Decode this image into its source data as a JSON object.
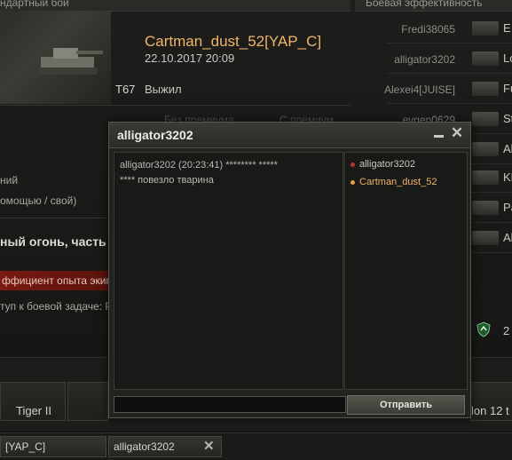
{
  "background": {
    "header_left": "ндартный бой",
    "header_right": "Боевая эффективность",
    "player_name": "Cartman_dust_52[YAP_C]",
    "battle_date": "22.10.2017 20:09",
    "tank_name": "T67",
    "status": "Выжил",
    "faded_col1": "Без премиума",
    "faded_col2": "С премиум",
    "left_line1": "ний",
    "left_line2": "омощью / свой)",
    "mission_title": "ный огонь, часть 1",
    "xp_bar": "ффициент опыта экипа",
    "access_line": "туп к боевой задаче: Р",
    "vehicle_left": "Tiger II",
    "vehicle_right": "lon 12 t",
    "right_count": "2",
    "team_rows": [
      {
        "name": "Fredi38065",
        "letter": "E"
      },
      {
        "name": "alligator3202",
        "letter": "Lo"
      },
      {
        "name": "Alexei4[JUISE]",
        "letter": "Fu"
      },
      {
        "name": "evgen0629",
        "letter": "St"
      },
      {
        "name": "",
        "letter": "Al"
      },
      {
        "name": "",
        "letter": "KE"
      },
      {
        "name": "",
        "letter": "Pa"
      },
      {
        "name": "",
        "letter": "Al"
      }
    ]
  },
  "bottom_tabs": [
    {
      "label": "[YAP_C]"
    },
    {
      "label": "alligator3202"
    }
  ],
  "chat": {
    "title": "alligator3202",
    "messages": [
      "alligator3202 (20:23:41) ******** *****",
      "**** повезло тварина"
    ],
    "members": [
      {
        "name": "alligator3202",
        "color": "#c8c6bf",
        "dot": "#b5372c"
      },
      {
        "name": "Cartman_dust_52",
        "color": "#f0b46a",
        "dot": "#e0a040"
      }
    ],
    "input_value": "",
    "send_label": "Отправить"
  }
}
